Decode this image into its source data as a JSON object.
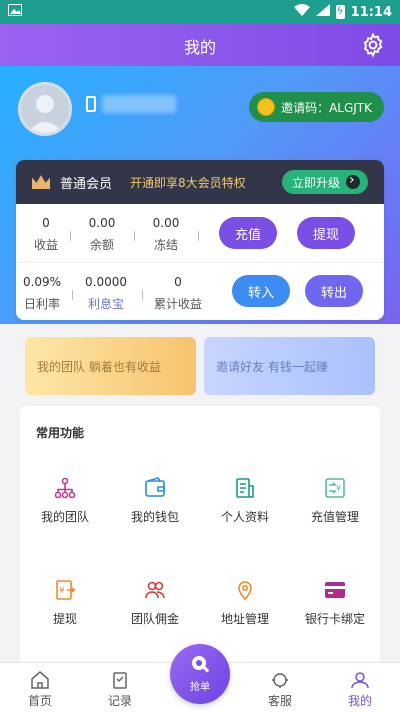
{
  "status": {
    "time": "11:14",
    "battery_glyph": "ϟ"
  },
  "header": {
    "title": "我的"
  },
  "profile": {
    "invite_code": "邀请码：ALGJTK"
  },
  "vip": {
    "level": "普通会员",
    "tip": "开通即享8大会员特权",
    "upgrade": "立即升级"
  },
  "stats_row1": [
    {
      "value": "0",
      "label": "收益"
    },
    {
      "value": "0.00",
      "label": "余额"
    },
    {
      "value": "0.00",
      "label": "冻结"
    }
  ],
  "stats_row2": [
    {
      "value": "0.09%",
      "label": "日利率"
    },
    {
      "value": "0.0000",
      "label": "利息宝"
    },
    {
      "value": "0",
      "label": "累计收益"
    }
  ],
  "buttons": {
    "recharge": "充值",
    "withdraw": "提现",
    "transfer_in": "转入",
    "transfer_out": "转出"
  },
  "banners": {
    "team": "我的团队 躺着也有收益",
    "invite": "邀请好友 有钱一起赚"
  },
  "functions": {
    "title": "常用功能",
    "items": [
      {
        "label": "我的团队",
        "icon": "team-icon",
        "color": "#c23a8a"
      },
      {
        "label": "我的钱包",
        "icon": "wallet-icon",
        "color": "#2a8fd6"
      },
      {
        "label": "个人资料",
        "icon": "profile-doc-icon",
        "color": "#1a9a8a"
      },
      {
        "label": "充值管理",
        "icon": "recharge-icon",
        "color": "#5bb99a"
      },
      {
        "label": "提现",
        "icon": "withdraw-icon",
        "color": "#f08a2c"
      },
      {
        "label": "团队佣金",
        "icon": "team-commission-icon",
        "color": "#d63a3a"
      },
      {
        "label": "地址管理",
        "icon": "location-icon",
        "color": "#f08a2c"
      },
      {
        "label": "银行卡绑定",
        "icon": "bank-card-icon",
        "color": "#b12c8f"
      }
    ]
  },
  "tabs": [
    {
      "label": "首页",
      "icon": "home-icon"
    },
    {
      "label": "记录",
      "icon": "record-icon"
    },
    {
      "label": "抢单",
      "icon": "grab-order-icon"
    },
    {
      "label": "客服",
      "icon": "service-icon"
    },
    {
      "label": "我的",
      "icon": "user-icon"
    }
  ],
  "colors": {
    "accent": "#7a4fe6",
    "statusbar": "#1e9e8f",
    "gradient_start": "#27b0ff",
    "gradient_end": "#7a63f0"
  }
}
